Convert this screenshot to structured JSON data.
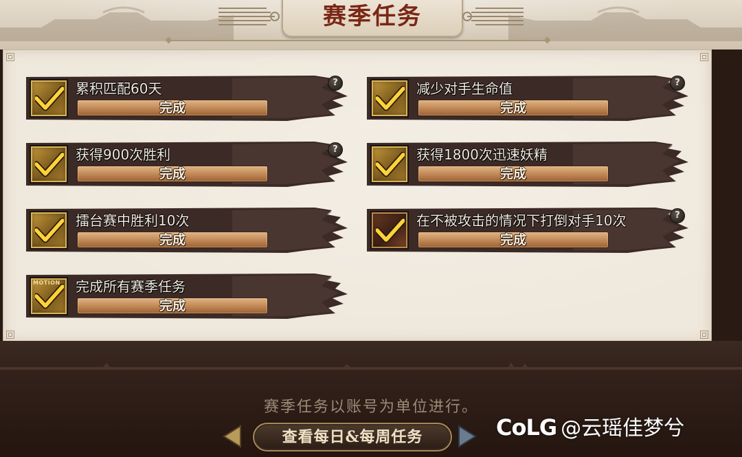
{
  "header": {
    "title": "赛季任务"
  },
  "tasks": [
    {
      "name": "累积匹配60天",
      "status": "完成",
      "progress": 1.0,
      "has_help": true,
      "icon": "check-icon"
    },
    {
      "name": "减少对手生命值",
      "status": "完成",
      "progress": 1.0,
      "has_help": true,
      "icon": "check-icon"
    },
    {
      "name": "获得900次胜利",
      "status": "完成",
      "progress": 1.0,
      "has_help": true,
      "icon": "check-icon"
    },
    {
      "name": "获得1800次迅速妖精",
      "status": "完成",
      "progress": 1.0,
      "has_help": false,
      "icon": "check-icon"
    },
    {
      "name": "擂台赛中胜利10次",
      "status": "完成",
      "progress": 1.0,
      "has_help": false,
      "icon": "check-icon"
    },
    {
      "name": "在不被攻击的情况下打倒对手10次",
      "status": "完成",
      "progress": 1.0,
      "has_help": true,
      "icon": "check-icon"
    },
    {
      "name": "完成所有赛季任务",
      "status": "完成",
      "progress": 1.0,
      "has_help": false,
      "icon": "check-icon",
      "icon_text": "MOTION"
    }
  ],
  "footer": {
    "notice": "赛季任务以账号为单位进行。",
    "view_button": "查看每日&每周任务",
    "help_symbol": "?"
  },
  "watermark": {
    "logo": "CoLG",
    "handle": "@云瑶佳梦兮"
  },
  "colors": {
    "title": "#7a2716",
    "bar": "#b77a46",
    "panel": "#efe8dc",
    "footer": "#2a1a14"
  }
}
